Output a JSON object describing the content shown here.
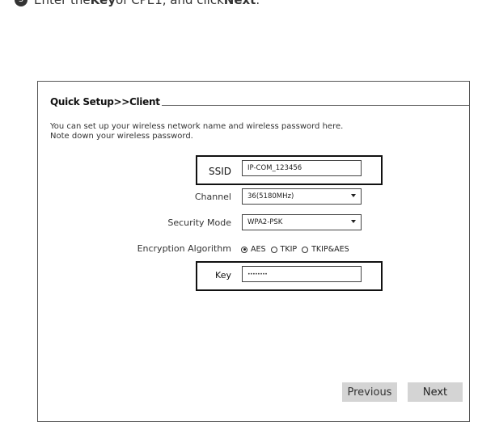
{
  "instruction": {
    "step_number": "3",
    "text_before": "Enter the ",
    "key_word": "Key",
    "text_middle": " of CPE1, and click ",
    "next_word": "Next",
    "text_end": "."
  },
  "dialog": {
    "title": "Quick Setup>>Client",
    "description_line1": "You can set up your wireless network name and wireless password here.",
    "description_line2": "Note down your wireless password.",
    "ssid": {
      "label": "SSID",
      "value": "IP-COM_123456"
    },
    "channel": {
      "label": "Channel",
      "value": "36(5180MHz)"
    },
    "security_mode": {
      "label": "Security Mode",
      "value": "WPA2-PSK"
    },
    "encryption": {
      "label": "Encryption Algorithm",
      "options": [
        "AES",
        "TKIP",
        "TKIP&AES"
      ],
      "selected": "AES"
    },
    "key": {
      "label": "Key",
      "value": "••••••••"
    },
    "buttons": {
      "previous": "Previous",
      "next": "Next"
    }
  }
}
